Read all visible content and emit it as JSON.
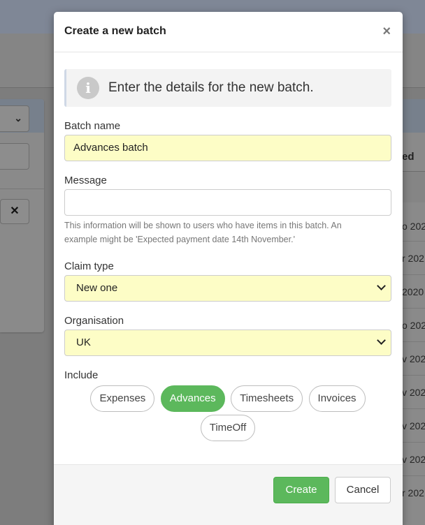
{
  "background": {
    "table_header": "ed",
    "rows": [
      "o 202",
      "r 202",
      "2020",
      "o 202",
      "v 202",
      "v 202",
      "v 202",
      "v 202",
      "r 202"
    ],
    "clear_icon": "close-icon"
  },
  "modal": {
    "title": "Create a new batch",
    "close_icon": "×",
    "info": {
      "icon": "i",
      "text": "Enter the details for the new batch."
    },
    "batch_name": {
      "label": "Batch name",
      "value": "Advances batch"
    },
    "message": {
      "label": "Message",
      "value": "",
      "help": "This information will be shown to users who have items in this batch. An example might be 'Expected payment date 14th November.'"
    },
    "claim_type": {
      "label": "Claim type",
      "value": "New one"
    },
    "organisation": {
      "label": "Organisation",
      "value": "UK"
    },
    "include": {
      "label": "Include",
      "options": [
        {
          "label": "Expenses",
          "active": false
        },
        {
          "label": "Advances",
          "active": true
        },
        {
          "label": "Timesheets",
          "active": false
        },
        {
          "label": "Invoices",
          "active": false
        },
        {
          "label": "TimeOff",
          "active": false
        }
      ]
    },
    "footer": {
      "create_label": "Create",
      "cancel_label": "Cancel"
    }
  },
  "colors": {
    "accent_green": "#5cb85c",
    "filled_field": "#fdfdc6"
  }
}
